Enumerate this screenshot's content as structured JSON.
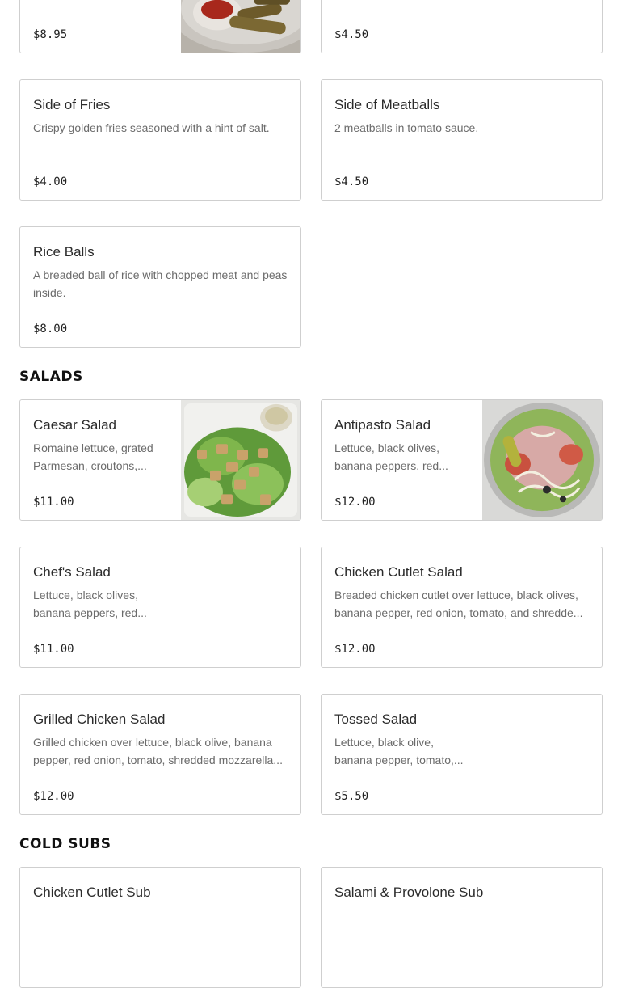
{
  "sections": {
    "salads": "SALADS",
    "cold_subs": "COLD SUBS"
  },
  "items": {
    "partial_left": {
      "price": "$8.95",
      "image": "fried-appetizer-photo"
    },
    "partial_right": {
      "price": "$4.50"
    },
    "side_fries": {
      "name": "Side of Fries",
      "desc": "Crispy golden fries seasoned with a hint of salt.",
      "price": "$4.00"
    },
    "side_meatballs": {
      "name": "Side of Meatballs",
      "desc": "2 meatballs in tomato sauce.",
      "price": "$4.50"
    },
    "rice_balls": {
      "name": "Rice Balls",
      "desc": "A breaded ball of rice with chopped meat and peas inside.",
      "price": "$8.00"
    },
    "caesar": {
      "name": "Caesar Salad",
      "desc": "Romaine lettuce, grated Parmesan, croutons,...",
      "price": "$11.00",
      "image": "caesar-salad-photo"
    },
    "antipasto": {
      "name": "Antipasto Salad",
      "desc": "Lettuce, black olives, banana peppers, red...",
      "price": "$12.00",
      "image": "antipasto-salad-photo"
    },
    "chefs": {
      "name": "Chef's Salad",
      "desc": "Lettuce, black olives, banana peppers, red...",
      "price": "$11.00"
    },
    "chicken_cutlet_salad": {
      "name": "Chicken Cutlet Salad",
      "desc": "Breaded chicken cutlet over lettuce, black olives, banana pepper, red onion, tomato, and shredde...",
      "price": "$12.00"
    },
    "grilled_chicken_salad": {
      "name": "Grilled Chicken Salad",
      "desc": "Grilled chicken over lettuce, black olive, banana pepper, red onion, tomato, shredded mozzarella...",
      "price": "$12.00"
    },
    "tossed": {
      "name": "Tossed Salad",
      "desc": "Lettuce, black olive, banana pepper, tomato,...",
      "price": "$5.50"
    },
    "chicken_cutlet_sub": {
      "name": "Chicken Cutlet Sub"
    },
    "salami_provolone_sub": {
      "name": "Salami & Provolone Sub"
    }
  }
}
